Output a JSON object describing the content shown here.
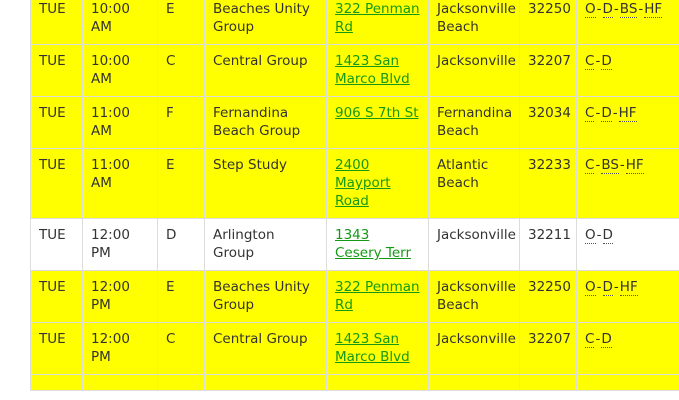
{
  "meetings": {
    "rows": [
      {
        "day": "TUE",
        "time": "10:00 AM",
        "district": "E",
        "group": "Beaches Unity Group",
        "address": "322 Penman Rd",
        "city": "Jacksonville Beach",
        "zip": "32250",
        "codes": [
          "O",
          "D",
          "BS",
          "HF"
        ],
        "highlight": true
      },
      {
        "day": "TUE",
        "time": "10:00 AM",
        "district": "C",
        "group": "Central Group",
        "address": "1423 San Marco Blvd",
        "city": "Jacksonville",
        "zip": "32207",
        "codes": [
          "C",
          "D"
        ],
        "highlight": true
      },
      {
        "day": "TUE",
        "time": "11:00 AM",
        "district": "F",
        "group": "Fernandina Beach Group",
        "address": "906 S 7th St",
        "city": "Fernandina Beach",
        "zip": "32034",
        "codes": [
          "C",
          "D",
          "HF"
        ],
        "highlight": true
      },
      {
        "day": "TUE",
        "time": "11:00 AM",
        "district": "E",
        "group": "Step Study",
        "address": "2400 Mayport Road",
        "city": "Atlantic Beach",
        "zip": "32233",
        "codes": [
          "C",
          "BS",
          "HF"
        ],
        "highlight": true
      },
      {
        "day": "TUE",
        "time": "12:00 PM",
        "district": "D",
        "group": "Arlington Group",
        "address": "1343 Cesery Terr",
        "city": "Jacksonville",
        "zip": "32211",
        "codes": [
          "O",
          "D"
        ],
        "highlight": false
      },
      {
        "day": "TUE",
        "time": "12:00 PM",
        "district": "E",
        "group": "Beaches Unity Group",
        "address": "322 Penman Rd",
        "city": "Jacksonville Beach",
        "zip": "32250",
        "codes": [
          "O",
          "D",
          "HF"
        ],
        "highlight": true
      },
      {
        "day": "TUE",
        "time": "12:00 PM",
        "district": "C",
        "group": "Central Group",
        "address": "1423 San Marco Blvd",
        "city": "Jacksonville",
        "zip": "32207",
        "codes": [
          "C",
          "D"
        ],
        "highlight": true
      },
      {
        "day": "",
        "time": "",
        "district": "",
        "group": "",
        "address": "",
        "city": "",
        "zip": "",
        "codes": [],
        "highlight": true
      }
    ]
  },
  "colors": {
    "highlight_row": "#ffff00",
    "link": "#159915",
    "border": "#dcdcdc",
    "text": "#333333"
  }
}
